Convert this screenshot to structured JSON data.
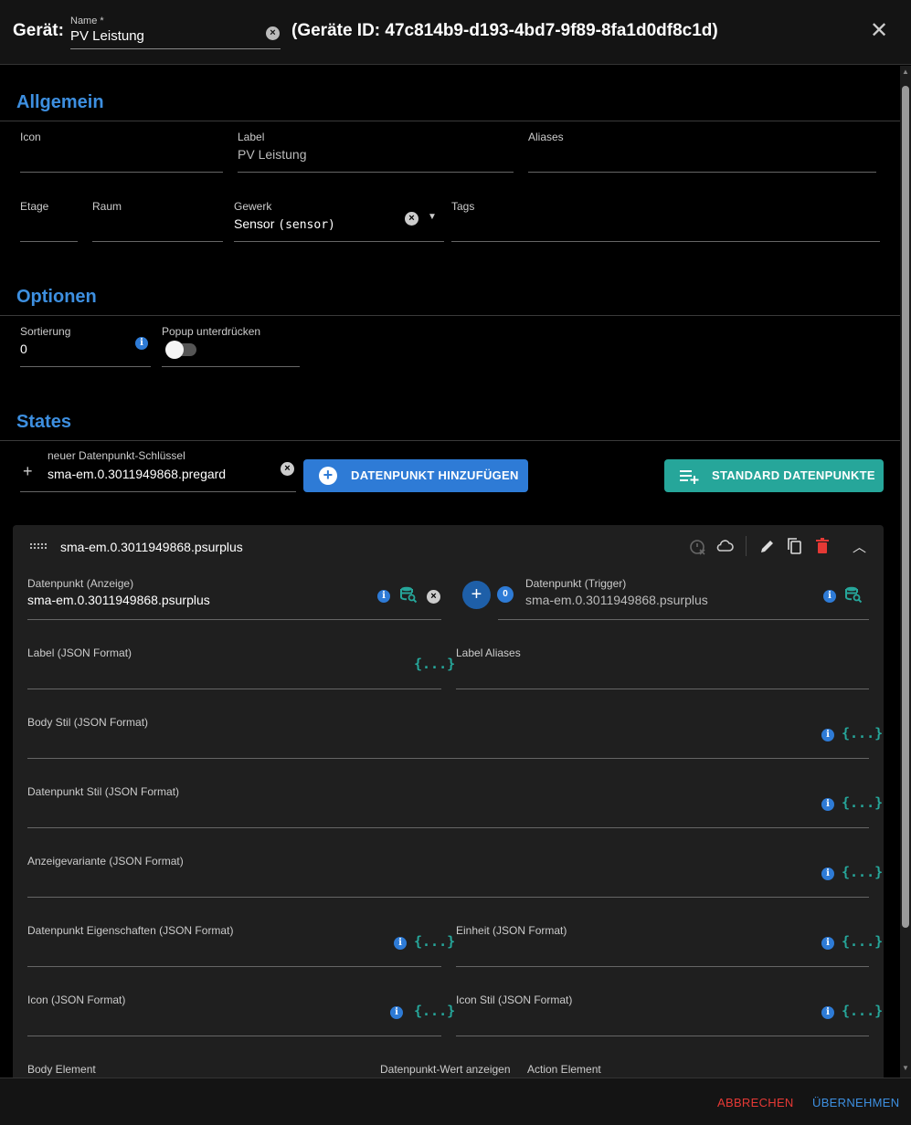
{
  "header": {
    "title": "Gerät:",
    "name_label": "Name *",
    "name_value": "PV Leistung",
    "device_id": "(Geräte ID: 47c814b9-d193-4bd7-9f89-8fa1d0df8c1d)",
    "close_icon": "close-icon"
  },
  "general": {
    "title": "Allgemein",
    "icon_label": "Icon",
    "icon_value": "",
    "label_label": "Label",
    "label_placeholder": "PV Leistung",
    "aliases_label": "Aliases",
    "aliases_value": "",
    "floor_label": "Etage",
    "room_label": "Raum",
    "trade_label": "Gewerk",
    "trade_value": "Sensor",
    "trade_key": "(sensor)",
    "tags_label": "Tags"
  },
  "options": {
    "title": "Optionen",
    "sort_label": "Sortierung",
    "sort_value": "0",
    "popup_label": "Popup unterdrücken",
    "popup_enabled": false
  },
  "states": {
    "title": "States",
    "new_key_label": "neuer Datenpunkt-Schlüssel",
    "new_key_value": "sma-em.0.3011949868.pregard",
    "add_button": "DATENPUNKT HINZUFÜGEN",
    "standard_button": "STANDARD DATENPUNKTE"
  },
  "state_card": {
    "title": "sma-em.0.3011949868.psurplus",
    "dp_display_label": "Datenpunkt (Anzeige)",
    "dp_display_value": "sma-em.0.3011949868.psurplus",
    "trigger_count": "0",
    "dp_trigger_label": "Datenpunkt (Trigger)",
    "dp_trigger_value": "sma-em.0.3011949868.psurplus",
    "label_json": "Label (JSON Format)",
    "label_aliases": "Label Aliases",
    "body_style": "Body Stil (JSON Format)",
    "dp_style": "Datenpunkt Stil (JSON Format)",
    "display_variant": "Anzeigevariante (JSON Format)",
    "dp_props": "Datenpunkt Eigenschaften (JSON Format)",
    "unit": "Einheit (JSON Format)",
    "icon_json": "Icon (JSON Format)",
    "icon_style": "Icon Stil (JSON Format)",
    "body_element": "Body Element",
    "show_value": "Datenpunkt-Wert anzeigen",
    "action_element": "Action Element",
    "json_glyph": "{...}",
    "info_glyph": "i"
  },
  "footer": {
    "cancel": "ABBRECHEN",
    "apply": "ÜBERNEHMEN"
  },
  "colors": {
    "accent": "#2e7bd6",
    "teal": "#26a69a",
    "danger": "#e53935"
  }
}
